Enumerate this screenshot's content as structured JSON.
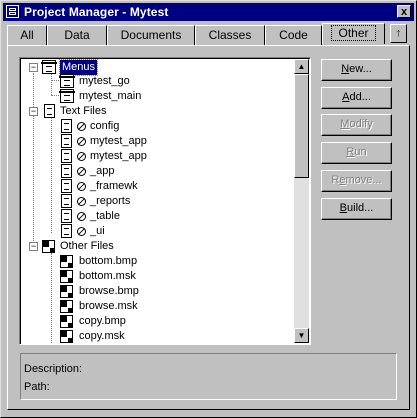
{
  "window": {
    "title": "Project Manager - Mytest",
    "close_label": "x"
  },
  "tabs": [
    {
      "label": "All"
    },
    {
      "label": "Data"
    },
    {
      "label": "Documents"
    },
    {
      "label": "Classes"
    },
    {
      "label": "Code"
    },
    {
      "label": "Other"
    }
  ],
  "tab_collapse_label": "↑",
  "tree": {
    "menus": {
      "label": "Menus",
      "expander": "−",
      "children": [
        "mytest_go",
        "mytest_main"
      ]
    },
    "text_files": {
      "label": "Text Files",
      "expander": "−",
      "children": [
        "config",
        "mytest_app",
        "mytest_app",
        "_app",
        "_framewk",
        "_reports",
        "_table",
        "_ui"
      ]
    },
    "other_files": {
      "label": "Other Files",
      "expander": "−",
      "children": [
        "bottom.bmp",
        "bottom.msk",
        "browse.bmp",
        "browse.msk",
        "copy.bmp",
        "copy.msk"
      ]
    }
  },
  "buttons": {
    "new": {
      "pre": "",
      "u": "N",
      "post": "ew..."
    },
    "add": {
      "pre": "",
      "u": "A",
      "post": "dd..."
    },
    "modify": {
      "pre": "",
      "u": "M",
      "post": "odify"
    },
    "run": {
      "pre": "",
      "u": "R",
      "post": "un"
    },
    "remove": {
      "pre": "R",
      "u": "e",
      "post": "move..."
    },
    "build": {
      "pre": "",
      "u": "B",
      "post": "uild..."
    }
  },
  "info": {
    "description_label": "Description:",
    "path_label": "Path:"
  }
}
